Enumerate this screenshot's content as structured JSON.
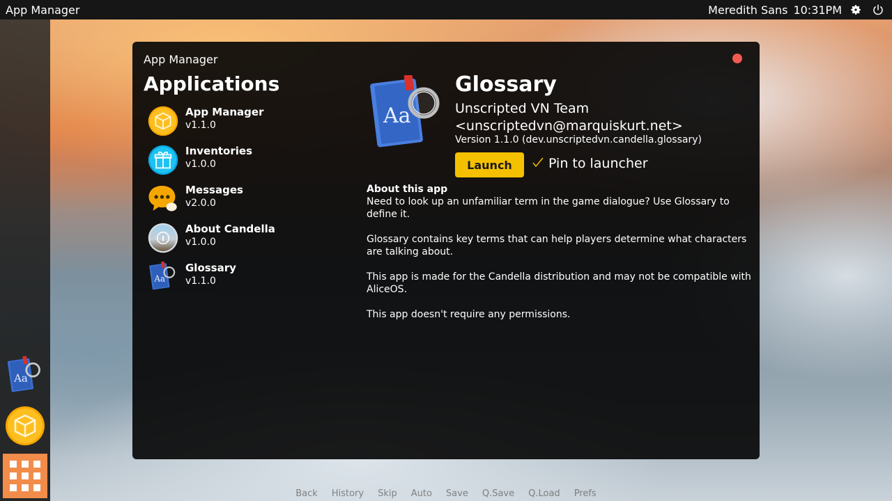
{
  "topbar": {
    "title": "App Manager",
    "user": "Meredith Sans",
    "time": "10:31PM",
    "settings_icon": "gear-icon",
    "power_icon": "power-icon"
  },
  "dock": {
    "items": [
      {
        "name": "Glossary",
        "icon": "glossary-icon"
      },
      {
        "name": "App Manager",
        "icon": "package-icon"
      }
    ],
    "apps_button_icon": "grid-icon",
    "apps_button_color": "#f28c4a"
  },
  "window": {
    "title": "App Manager",
    "close_color": "#f25b52"
  },
  "applications": {
    "heading": "Applications",
    "items": [
      {
        "name": "App Manager",
        "version": "v1.1.0",
        "icon": "package-icon"
      },
      {
        "name": "Inventories",
        "version": "v1.0.0",
        "icon": "gift-icon"
      },
      {
        "name": "Messages",
        "version": "v2.0.0",
        "icon": "chat-bubble-icon"
      },
      {
        "name": "About Candella",
        "version": "v1.0.0",
        "icon": "info-icon"
      },
      {
        "name": "Glossary",
        "version": "v1.1.0",
        "icon": "glossary-icon"
      }
    ]
  },
  "detail": {
    "name": "Glossary",
    "author": "Unscripted VN Team <unscriptedvn@marquiskurt.net>",
    "version": "Version 1.1.0 (dev.unscriptedvn.candella.glossary)",
    "launch_label": "Launch",
    "pin_label": "Pin to launcher",
    "pin_checked": true,
    "accent": "#f5c000",
    "about_heading": "About this app",
    "about_paragraphs": [
      "Need to look up an unfamiliar term in the game dialogue? Use Glossary to define it.",
      "Glossary contains key terms that can help players determine what characters are talking about.",
      "This app is made for the Candella distribution and may not be compatible with AliceOS."
    ],
    "permissions": "This app doesn't require any permissions."
  },
  "quick_menu": [
    "Back",
    "History",
    "Skip",
    "Auto",
    "Save",
    "Q.Save",
    "Q.Load",
    "Prefs"
  ]
}
